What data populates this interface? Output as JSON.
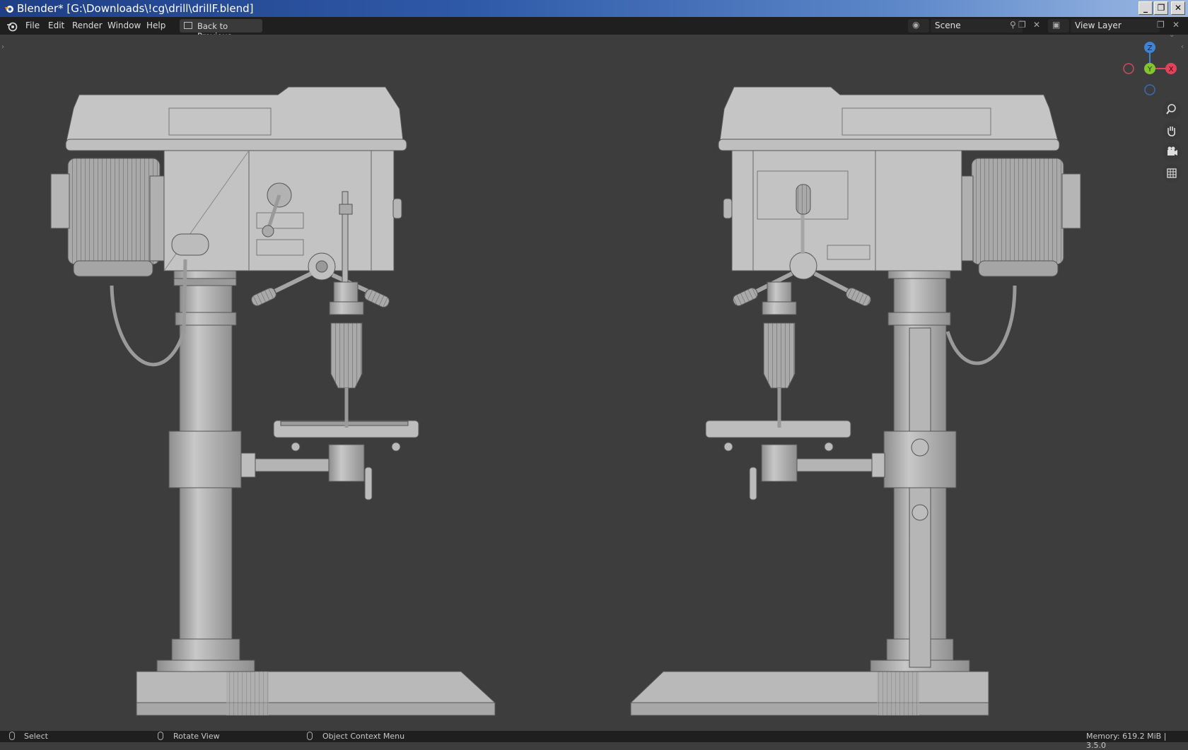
{
  "window": {
    "title": "Blender* [G:\\Downloads\\!cg\\drill\\drillF.blend]",
    "controls": {
      "minimize": "_",
      "restore": "❐",
      "close": "✕"
    }
  },
  "menubar": {
    "items": [
      "File",
      "Edit",
      "Render",
      "Window",
      "Help"
    ],
    "back_button": "Back to Previous",
    "scene": {
      "label": "Scene"
    },
    "view_layer": {
      "label": "View Layer"
    }
  },
  "gizmo": {
    "z": "Z",
    "y": "Y",
    "x": "X",
    "colors": {
      "x": "#e2425a",
      "y": "#83c42f",
      "z": "#3c84d8"
    }
  },
  "navigation_icons": [
    "zoom-icon",
    "hand-pan-icon",
    "camera-icon",
    "grid-icon"
  ],
  "statusbar": {
    "select": "Select",
    "rotate": "Rotate View",
    "context": "Object Context Menu",
    "memory": "Memory: 619.2 MiB | 3.5.0"
  }
}
